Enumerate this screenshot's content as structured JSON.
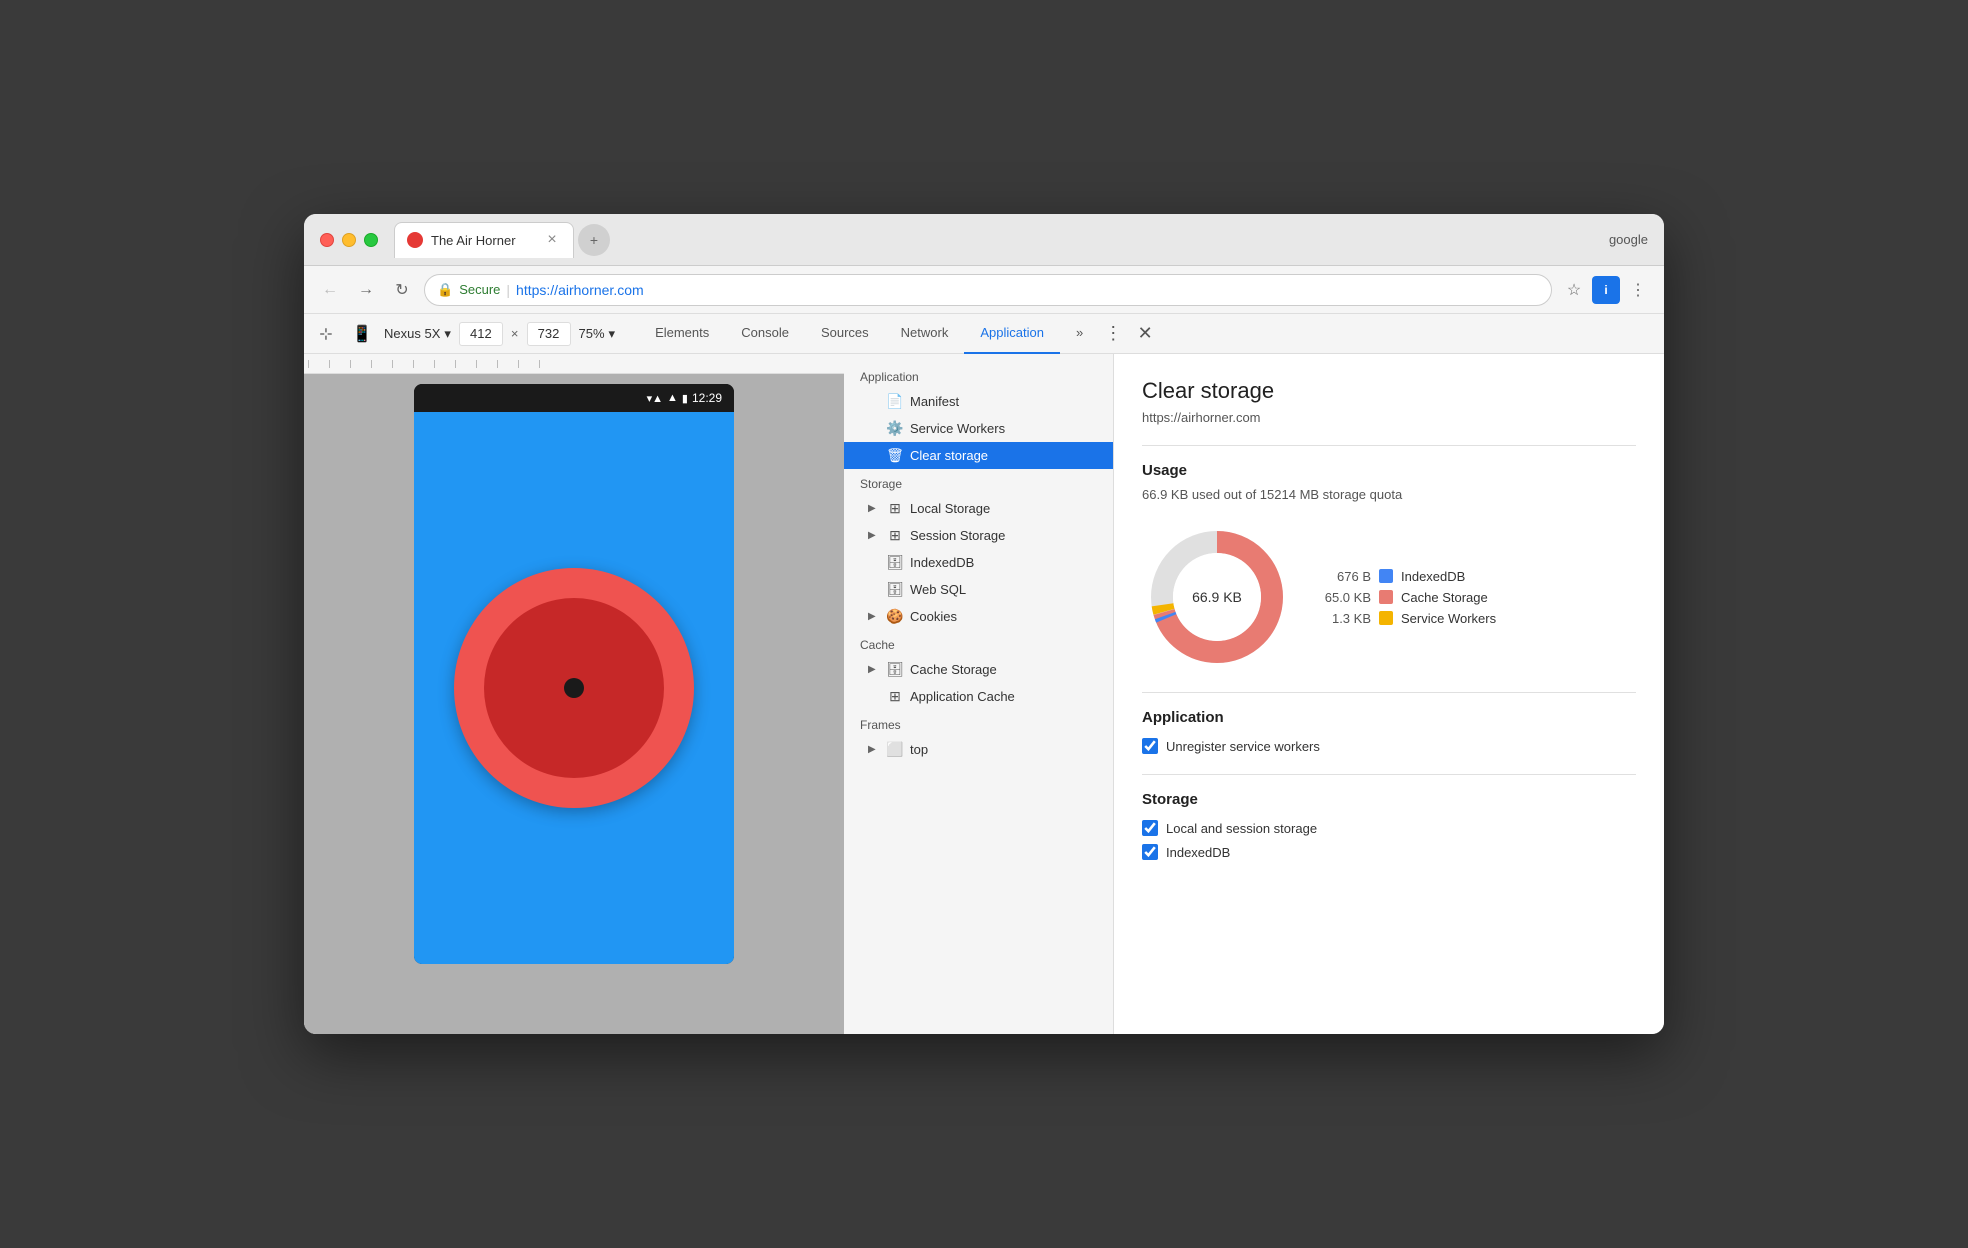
{
  "window": {
    "google_label": "google"
  },
  "tab": {
    "title": "The Air Horner",
    "close_label": "×"
  },
  "address_bar": {
    "secure_text": "Secure",
    "url_prefix": "https://",
    "url_domain": "airhorner.com"
  },
  "device_toolbar": {
    "device_name": "Nexus 5X",
    "width": "412",
    "x_label": "×",
    "height": "732",
    "zoom": "75%"
  },
  "devtools_tabs": [
    {
      "label": "Elements",
      "active": false
    },
    {
      "label": "Console",
      "active": false
    },
    {
      "label": "Sources",
      "active": false
    },
    {
      "label": "Network",
      "active": false
    },
    {
      "label": "Application",
      "active": true
    }
  ],
  "sidebar": {
    "application_label": "Application",
    "items_app": [
      {
        "label": "Manifest",
        "icon": "📄",
        "has_arrow": false
      },
      {
        "label": "Service Workers",
        "icon": "⚙️",
        "has_arrow": false
      },
      {
        "label": "Clear storage",
        "icon": "🗑",
        "has_arrow": false,
        "active": true
      }
    ],
    "storage_label": "Storage",
    "items_storage": [
      {
        "label": "Local Storage",
        "icon": "⊞",
        "has_arrow": true
      },
      {
        "label": "Session Storage",
        "icon": "⊞",
        "has_arrow": true
      },
      {
        "label": "IndexedDB",
        "icon": "🗄",
        "has_arrow": false
      },
      {
        "label": "Web SQL",
        "icon": "🗄",
        "has_arrow": false
      },
      {
        "label": "Cookies",
        "icon": "🍪",
        "has_arrow": true
      }
    ],
    "cache_label": "Cache",
    "items_cache": [
      {
        "label": "Cache Storage",
        "icon": "🗄",
        "has_arrow": true
      },
      {
        "label": "Application Cache",
        "icon": "⊞",
        "has_arrow": false
      }
    ],
    "frames_label": "Frames",
    "items_frames": [
      {
        "label": "top",
        "icon": "⬜",
        "has_arrow": true
      }
    ]
  },
  "panel": {
    "title": "Clear storage",
    "url": "https://airhorner.com",
    "usage_section": "Usage",
    "usage_text": "66.9 KB used out of 15214 MB storage quota",
    "donut_label": "66.9 KB",
    "legend": [
      {
        "value": "676 B",
        "label": "IndexedDB",
        "color": "#4285f4"
      },
      {
        "value": "65.0 KB",
        "label": "Cache Storage",
        "color": "#e87b72"
      },
      {
        "value": "1.3 KB",
        "label": "Service Workers",
        "color": "#f4b400"
      }
    ],
    "application_section": "Application",
    "checkboxes_app": [
      {
        "label": "Unregister service workers",
        "checked": true
      }
    ],
    "storage_section": "Storage",
    "checkboxes_storage": [
      {
        "label": "Local and session storage",
        "checked": true
      },
      {
        "label": "IndexedDB",
        "checked": true
      }
    ]
  },
  "phone": {
    "time": "12:29"
  },
  "icons": {
    "back": "←",
    "forward": "→",
    "reload": "↻",
    "star": "☆",
    "more_vert": "⋮",
    "device_toggle": "📱",
    "select_mode": "⊹",
    "chevron_down": "▾",
    "more_tabs": "»"
  }
}
